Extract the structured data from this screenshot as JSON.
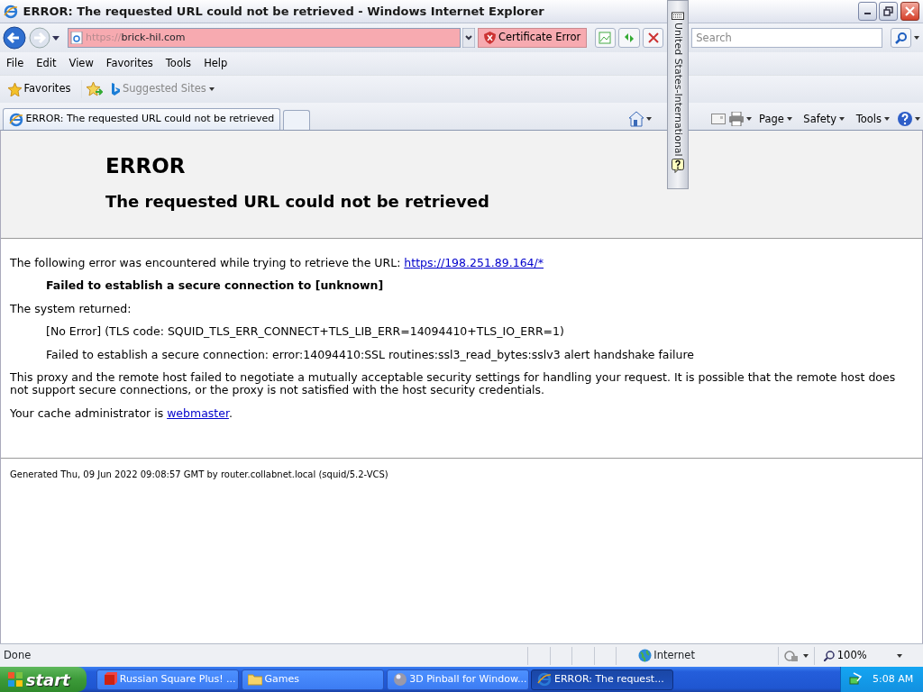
{
  "window": {
    "title": "ERROR: The requested URL could not be retrieved - Windows Internet Explorer"
  },
  "address_bar": {
    "scheme": "https://",
    "host": "brick-hil.com",
    "certificate_error": "Certificate Error"
  },
  "search": {
    "placeholder": "Search"
  },
  "menu": [
    "File",
    "Edit",
    "View",
    "Favorites",
    "Tools",
    "Help"
  ],
  "favorites_bar": {
    "favorites": "Favorites",
    "suggested_sites": "Suggested Sites"
  },
  "tabs": [
    {
      "label": "ERROR: The requested URL could not be retrieved",
      "selected": true
    }
  ],
  "command_bar": [
    "Page",
    "Safety",
    "Tools"
  ],
  "language_bar": {
    "label": "United States-International"
  },
  "page": {
    "heading": "ERROR",
    "subheading": "The requested URL could not be retrieved",
    "intro": "The following error was encountered while trying to retrieve the URL: ",
    "url": "https://198.251.89.164/*",
    "error": "Failed to establish a secure connection to [unknown]",
    "system_returned": "The system returned:",
    "details": [
      "[No Error] (TLS code: SQUID_TLS_ERR_CONNECT+TLS_LIB_ERR=14094410+TLS_IO_ERR=1)",
      "Failed to establish a secure connection: error:14094410:SSL routines:ssl3_read_bytes:sslv3 alert handshake failure"
    ],
    "explanation": "This proxy and the remote host failed to negotiate a mutually acceptable security settings for handling your request. It is possible that the remote host does not support secure connections, or the proxy is not satisfied with the host security credentials.",
    "admin": "Your cache administrator is ",
    "admin_link": "webmaster",
    "admin_end": ".",
    "footer": "Generated Thu, 09 Jun 2022 09:08:57 GMT by router.collabnet.local (squid/5.2-VCS)"
  },
  "status_bar": {
    "status": "Done",
    "zone": "Internet",
    "zoom": "100%"
  },
  "taskbar": {
    "start": "start",
    "clock": "5:08 AM",
    "items": [
      {
        "label": "Russian Square Plus! ...",
        "kind": "cube",
        "selected": false
      },
      {
        "label": "Games",
        "kind": "folder",
        "selected": false
      },
      {
        "label": "3D Pinball for Window...",
        "kind": "ball",
        "selected": false
      },
      {
        "label": "ERROR: The request...",
        "kind": "ie",
        "selected": true
      }
    ]
  }
}
